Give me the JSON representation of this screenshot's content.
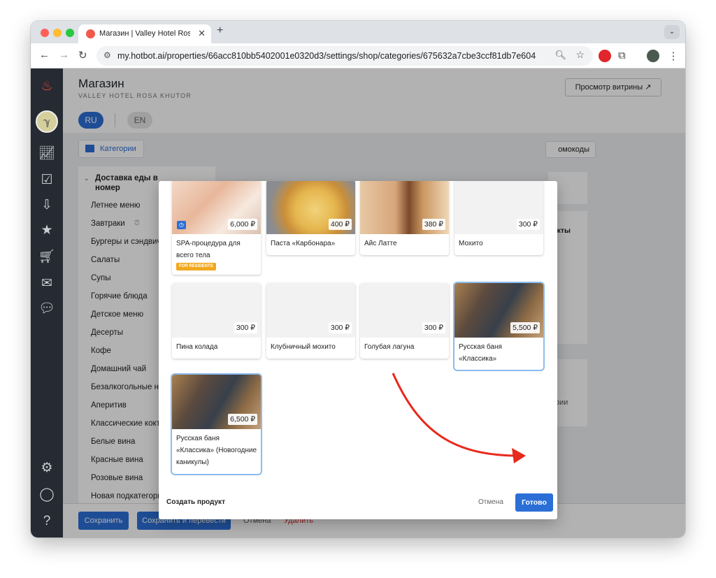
{
  "browser": {
    "tab_title": "Магазин | Valley Hotel Rosa Khutor",
    "url": "my.hotbot.ai/properties/66acc810bb5402001e0320d3/settings/shop/categories/675632a7cbe3ccf81db7e604",
    "traffic_colors": [
      "#ff5f57",
      "#febc2e",
      "#28c840"
    ]
  },
  "header": {
    "title": "Магазин",
    "subtitle": "VALLEY HOTEL ROSA KHUTOR",
    "preview_button": "Просмотр витрины",
    "preview_icon": "↗"
  },
  "languages": {
    "ru": "RU",
    "en": "EN"
  },
  "tabs": {
    "categories": "Категории",
    "promocodes": "омокоды"
  },
  "sidebar_categories": {
    "group": "Доставка еды в номер",
    "items": [
      "Летнее меню",
      "Завтраки",
      "Бургеры и сэндвичи",
      "Салаты",
      "Супы",
      "Горячие блюда",
      "Детское меню",
      "Десерты",
      "Кофе",
      "Домашний чай",
      "Безалкогольные напитки",
      "Аперитив",
      "Классические коктейли",
      "Белые вина",
      "Красные вина",
      "Розовые вина",
      "Новая подкатегория"
    ]
  },
  "right_panels": {
    "products_label": "дукты",
    "categories_label": "гории"
  },
  "footer": {
    "save": "Сохранить",
    "save_translate": "Сохранить и перевести",
    "cancel": "Отмена",
    "delete": "Удалить"
  },
  "modal": {
    "products": [
      {
        "name": "SPA-процедура для всего тела",
        "price": "6,000 ₽",
        "badge": "FOR RESIDENTS",
        "image": "spa",
        "selected": false
      },
      {
        "name": "Паста «Карбонара»",
        "price": "400 ₽",
        "image": "pasta",
        "selected": false
      },
      {
        "name": "Айс Латте",
        "price": "380 ₽",
        "image": "latte",
        "selected": false
      },
      {
        "name": "Мохито",
        "price": "300 ₽",
        "image": "none",
        "selected": false
      },
      {
        "name": "Пина колада",
        "price": "300 ₽",
        "image": "none",
        "selected": false
      },
      {
        "name": "Клубничный мохито",
        "price": "300 ₽",
        "image": "none",
        "selected": false
      },
      {
        "name": "Голубая лагуна",
        "price": "300 ₽",
        "image": "none",
        "selected": false
      },
      {
        "name": "Русская баня «Классика»",
        "price": "5,500 ₽",
        "image": "banya",
        "selected": true
      },
      {
        "name": "Русская баня «Классика» (Новогодние каникулы)",
        "price": "6,500 ₽",
        "image": "banya",
        "selected": true
      }
    ],
    "create_product": "Создать продукт",
    "cancel": "Отмена",
    "done": "Готово"
  },
  "colors": {
    "accent": "#2b6fd6",
    "sidebar": "#262b33",
    "danger": "#d42b2b",
    "arrow": "#e8291c",
    "badge": "#f1a81f"
  }
}
